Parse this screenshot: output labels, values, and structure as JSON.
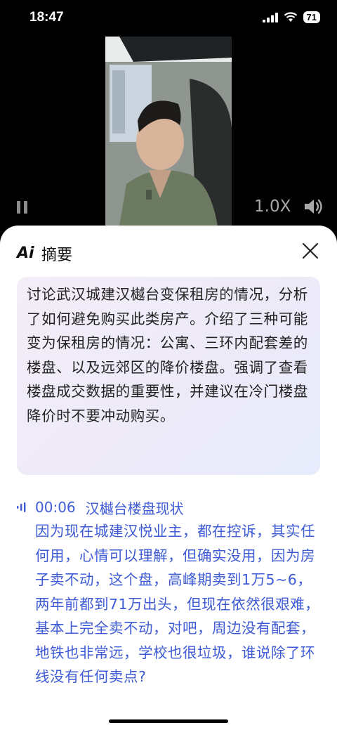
{
  "status": {
    "time": "18:47",
    "battery": "71"
  },
  "player": {
    "speed": "1.0X"
  },
  "sheet": {
    "logo": "Ai",
    "title": "摘要",
    "summary": "讨论武汉城建汉樾台变保租房的情况，分析了如何避免购买此类房产。介绍了三种可能变为保租房的情况：公寓、三环内配套差的楼盘、以及远郊区的降价楼盘。强调了查看楼盘成交数据的重要性，并建议在冷门楼盘降价时不要冲动购买。",
    "chapters": [
      {
        "time": "00:06",
        "title": "汉樾台楼盘现状",
        "text": "因为现在城建汉悦业主，都在控诉，其实任何用，心情可以理解，但确实没用，因为房子卖不动，这个盘，高峰期卖到1万5~6，两年前都到71万出头，但现在依然很艰难，基本上完全卖不动，对吧，周边没有配套，地铁也非常远，学校也很垃圾，谁说除了环线没有任何卖点?"
      }
    ]
  },
  "colors": {
    "accent": "#3e5bd5"
  }
}
